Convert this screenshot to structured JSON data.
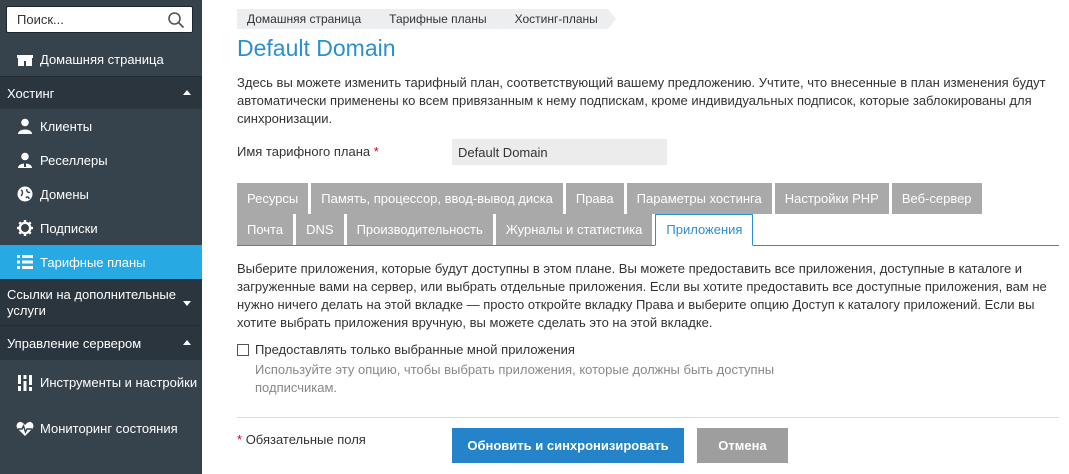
{
  "search": {
    "placeholder": "Поиск...",
    "icon": "search-icon"
  },
  "sidebar": {
    "home_label": "Домашняя страница",
    "hosting": {
      "title": "Хостинг",
      "items": [
        {
          "label": "Клиенты",
          "icon": "user-icon"
        },
        {
          "label": "Реселлеры",
          "icon": "reseller-icon"
        },
        {
          "label": "Домены",
          "icon": "globe-icon"
        },
        {
          "label": "Подписки",
          "icon": "gear-icon"
        },
        {
          "label": "Тарифные планы",
          "icon": "list-icon"
        }
      ]
    },
    "links_section": "Ссылки на дополнительные услуги",
    "server_section": "Управление сервером",
    "server_items": [
      {
        "label": "Инструменты и настройки",
        "icon": "tools-icon"
      },
      {
        "label": "Мониторинг состояния",
        "icon": "heart-pulse-icon"
      }
    ]
  },
  "breadcrumb": [
    "Домашняя страница",
    "Тарифные планы",
    "Хостинг-планы"
  ],
  "title": "Default Domain",
  "intro": "Здесь вы можете изменить тарифный план, соответствующий вашему предложению. Учтите, что внесенные в план изменения будут автоматически применены ко всем привязанным к нему подпискам, кроме индивидуальных подписок, которые заблокированы для синхронизации.",
  "plan_name": {
    "label": "Имя тарифного плана",
    "required_mark": "*",
    "value": "Default Domain"
  },
  "tabs_row1": [
    "Ресурсы",
    "Память, процессор, ввод-вывод диска",
    "Права",
    "Параметры хостинга",
    "Настройки PHP",
    "Веб-сервер"
  ],
  "tabs_row2": [
    "Почта",
    "DNS",
    "Производительность",
    "Журналы и статистика",
    "Приложения"
  ],
  "active_tab": "Приложения",
  "tab_description": "Выберите приложения, которые будут доступны в этом плане. Вы можете предоставить все приложения, доступные в каталоге и загруженные вами на сервер, или выбрать отдельные приложения. Если вы хотите предоставить все доступные приложения, вам не нужно ничего делать на этой вкладке — просто откройте вкладку Права и выберите опцию Доступ к каталогу приложений. Если вы хотите выбрать приложения вручную, вы можете сделать это на этой вкладке.",
  "checkbox": {
    "label": "Предоставлять только выбранные мной приложения",
    "checked": false
  },
  "hint": "Используйте эту опцию, чтобы выбрать приложения, которые должны быть доступны подписчикам.",
  "footer": {
    "required_mark": "*",
    "required_note": "Обязательные поля",
    "primary_button": "Обновить и синхронизировать",
    "cancel_button": "Отмена"
  },
  "colors": {
    "sidebar_bg": "#36424c",
    "active_item": "#27a9e3",
    "title": "#2b8fd1",
    "primary_btn": "#2584c9",
    "tab_bg": "#a9a9a9"
  }
}
